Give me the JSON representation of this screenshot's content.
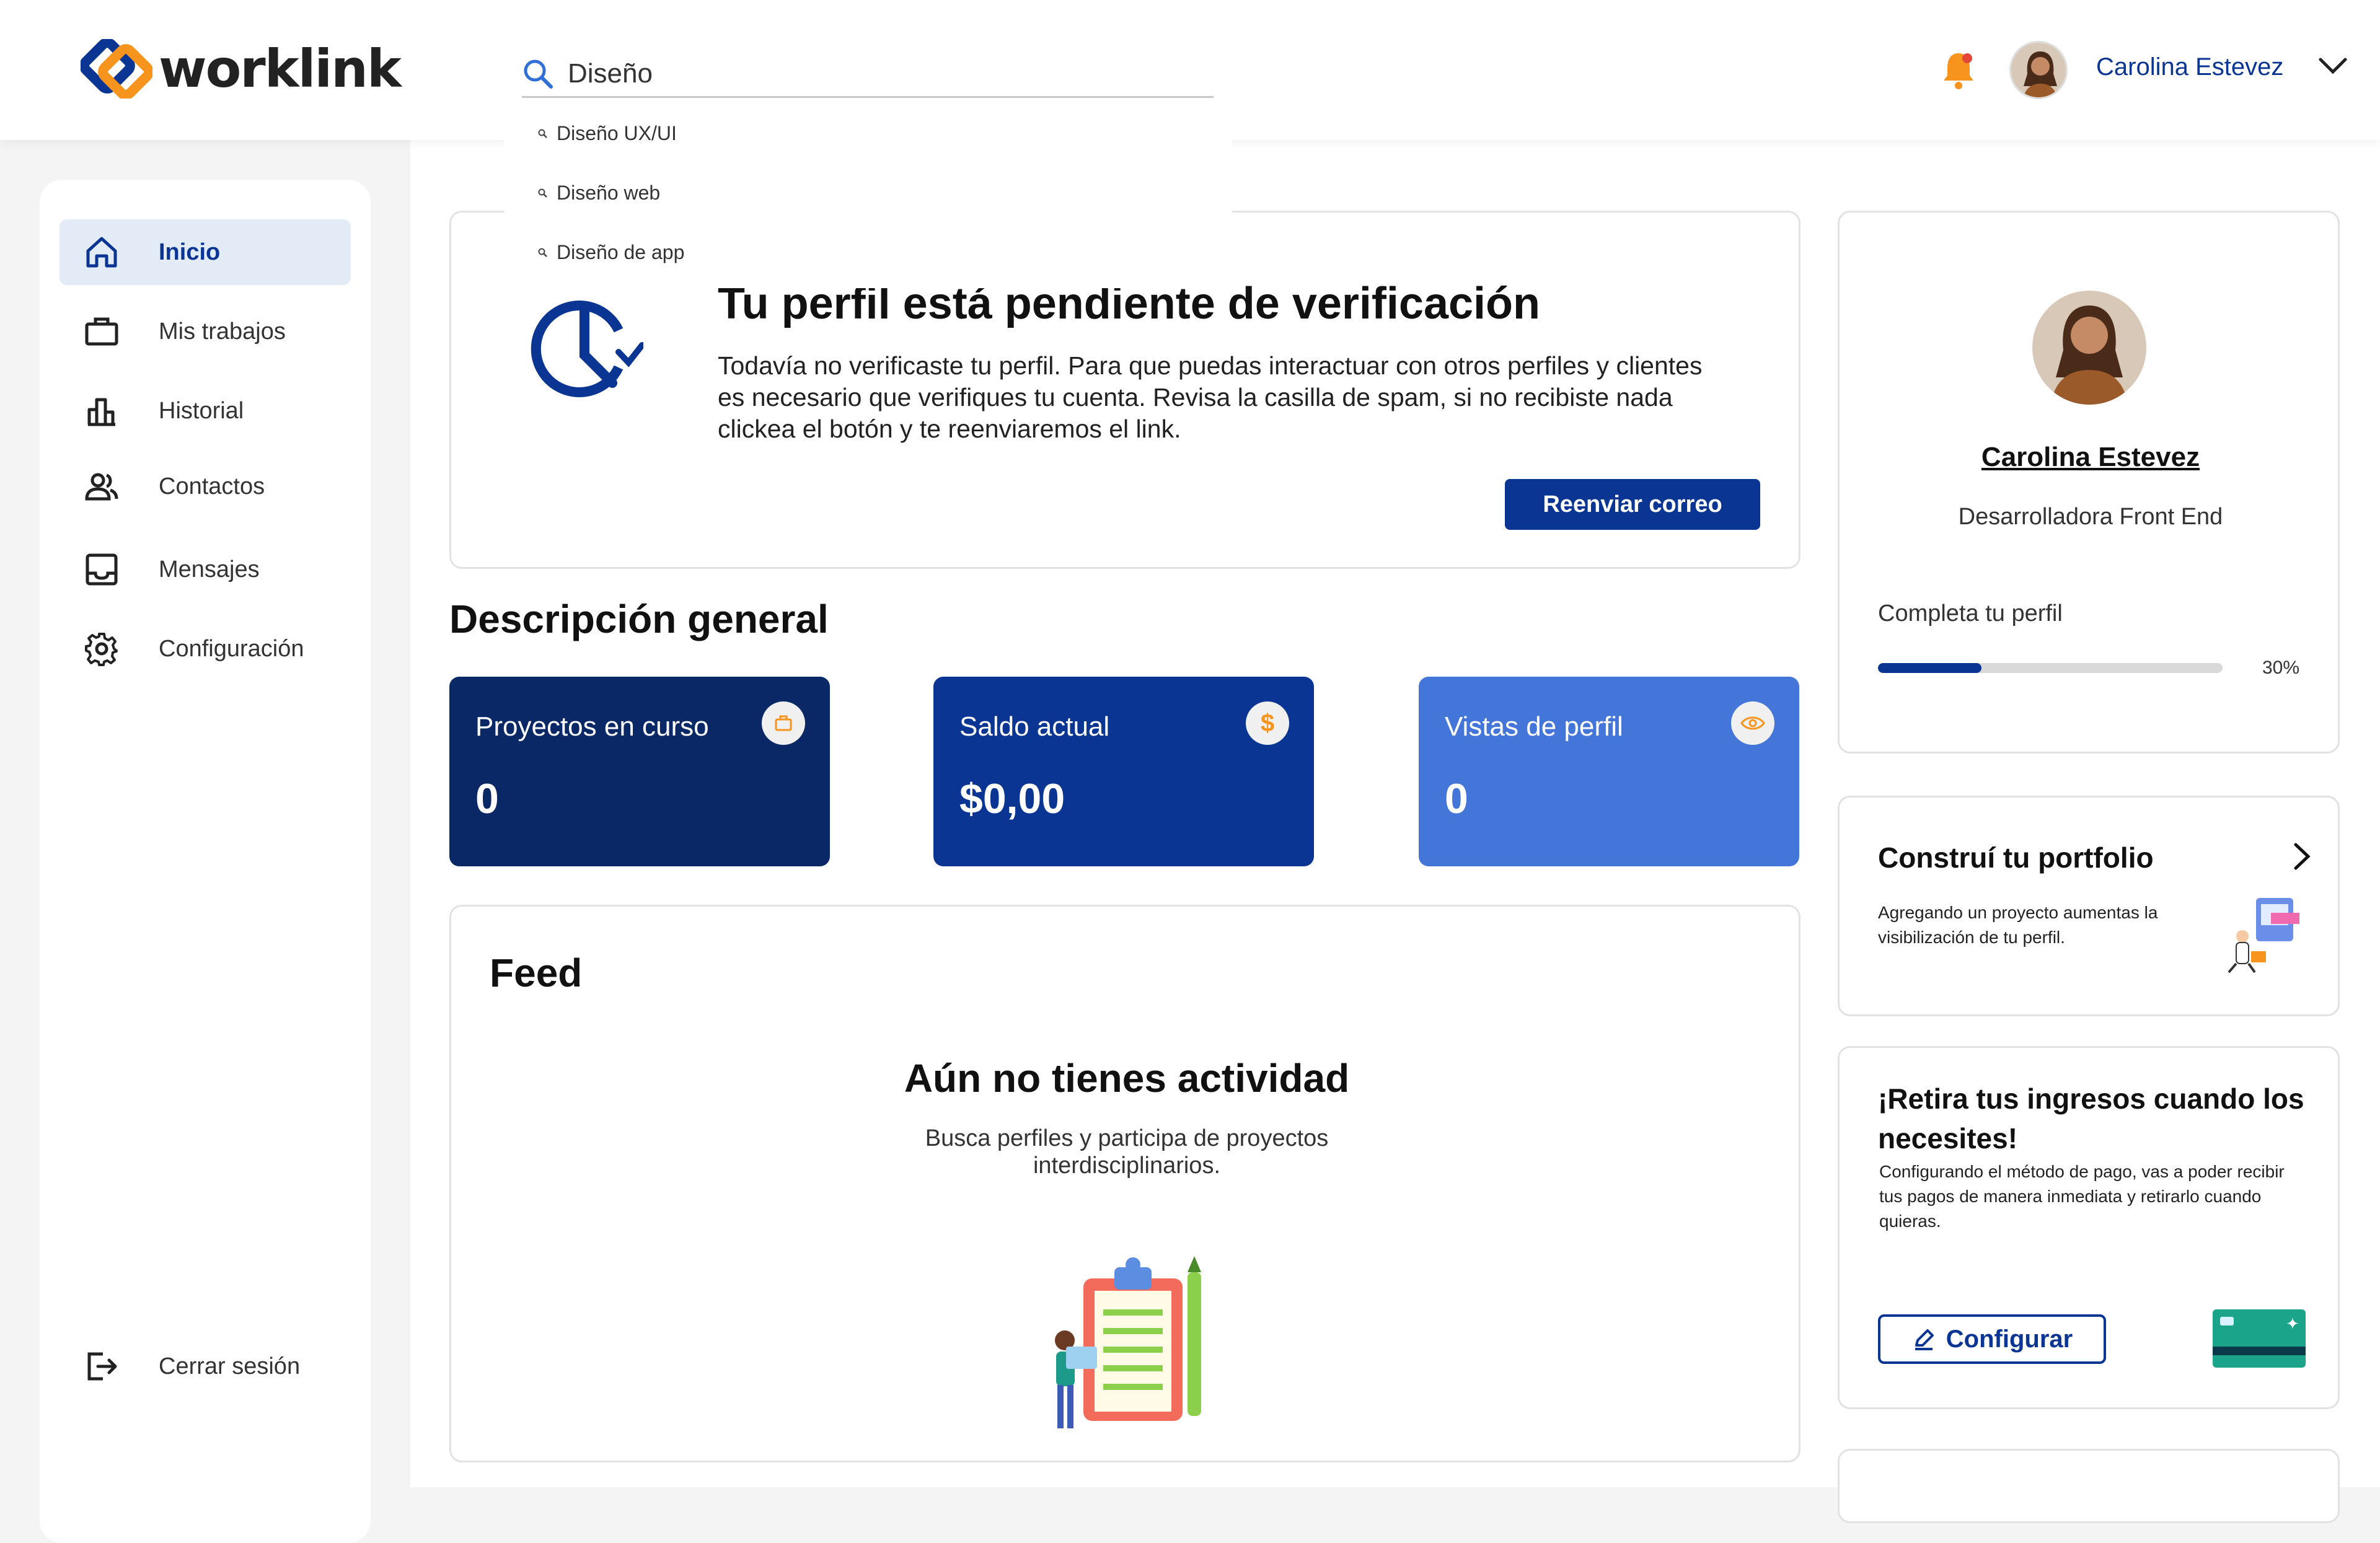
{
  "app": {
    "logo_text": "worklink",
    "brand_color": "#0a3592",
    "accent_color": "#f7941d"
  },
  "header": {
    "search": {
      "value": "Diseño",
      "suggestions": [
        "Diseño UX/UI",
        "Diseño web",
        "Diseño de app"
      ]
    },
    "user_name": "Carolina Estevez"
  },
  "sidebar": {
    "items": [
      {
        "label": "Inicio",
        "icon": "home-icon"
      },
      {
        "label": "Mis trabajos",
        "icon": "briefcase-icon"
      },
      {
        "label": "Historial",
        "icon": "bar-chart-icon"
      },
      {
        "label": "Contactos",
        "icon": "contacts-icon"
      },
      {
        "label": "Mensajes",
        "icon": "inbox-icon"
      },
      {
        "label": "Configuración",
        "icon": "gear-icon"
      }
    ],
    "logout_label": "Cerrar sesión"
  },
  "verification": {
    "title": "Tu perfil está pendiente de verificación",
    "text": "Todavía no verificaste tu perfil. Para que puedas interactuar con otros perfiles y clientes es necesario que verifiques tu cuenta. Revisa la casilla de spam, si no recibiste nada clickea el botón y te reenviaremos el link.",
    "button": "Reenviar correo"
  },
  "overview": {
    "title": "Descripción general",
    "stats": [
      {
        "label": "Proyectos en curso",
        "value": "0",
        "icon": "briefcase-icon",
        "color": "#0b2866"
      },
      {
        "label": "Saldo actual",
        "value": "$0,00",
        "icon": "dollar-icon",
        "color": "#0a3592"
      },
      {
        "label": "Vistas de perfil",
        "value": "0",
        "icon": "eye-icon",
        "color": "#4475d9"
      }
    ]
  },
  "feed": {
    "title": "Feed",
    "empty_title": "Aún no tienes actividad",
    "empty_text": "Busca perfiles y participa de proyectos interdisciplinarios."
  },
  "profile": {
    "name": "Carolina Estevez",
    "role": "Desarrolladora Front End",
    "complete_label": "Completa tu perfil",
    "progress": 0.3,
    "progress_text": "30%"
  },
  "portfolio": {
    "title": "Construí tu portfolio",
    "text": "Agregando un proyecto aumentas la visibilización de tu perfil."
  },
  "withdraw": {
    "title": "¡Retira tus ingresos cuando los necesites!",
    "text": "Configurando el método de pago, vas a poder recibir tus pagos de manera inmediata y retirarlo cuando quieras.",
    "button": "Configurar"
  }
}
